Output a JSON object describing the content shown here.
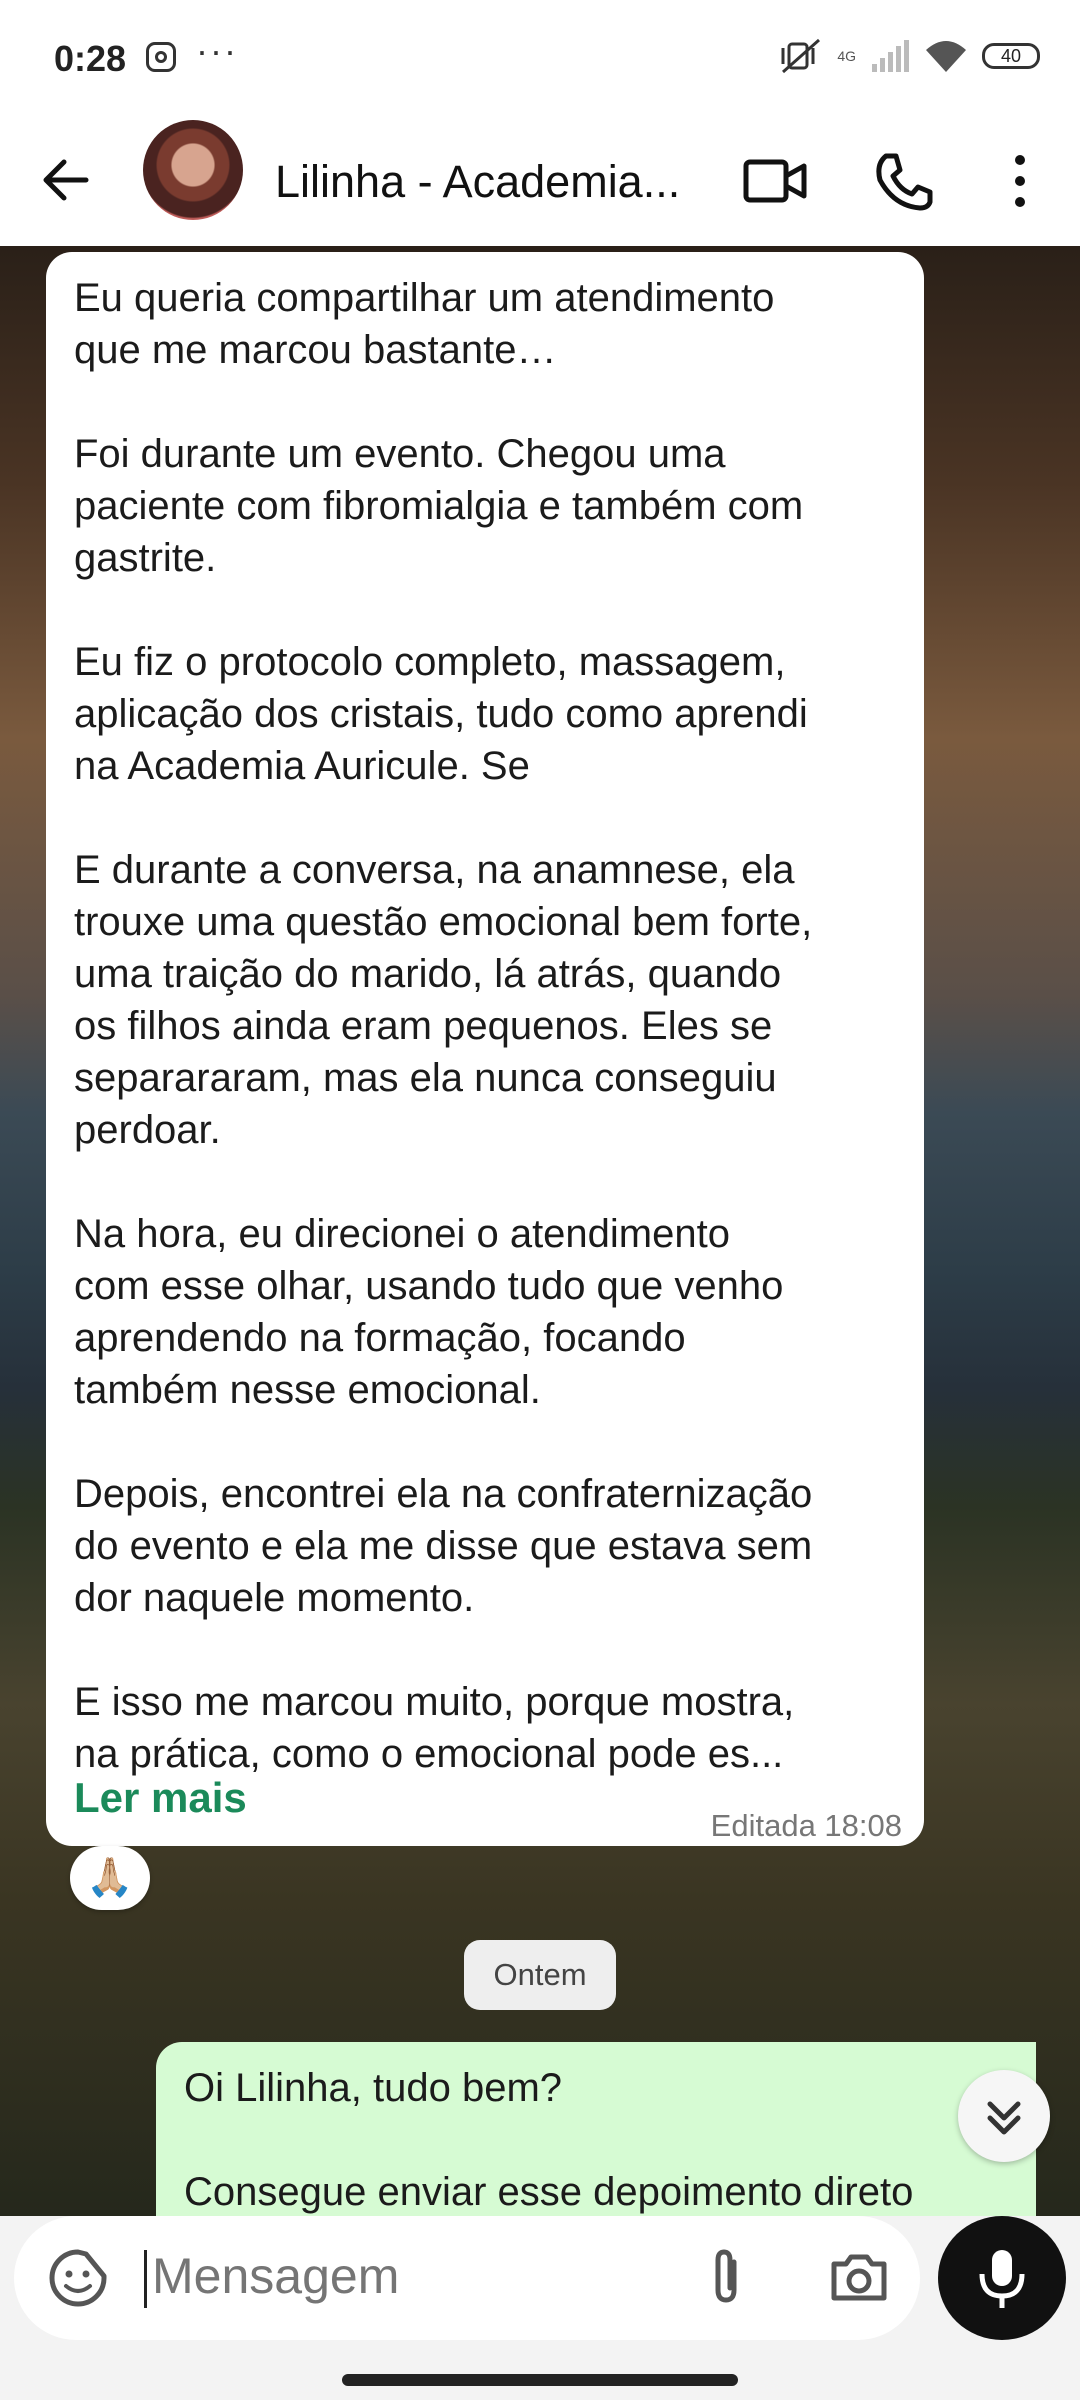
{
  "status_bar": {
    "time": "0:28",
    "battery": "40",
    "network": "4G"
  },
  "header": {
    "title": "Lilinha - Academia...",
    "icons": [
      "back-arrow-icon",
      "video-call-icon",
      "phone-icon",
      "more-vert-icon"
    ]
  },
  "messages": {
    "incoming": {
      "text": "Eu queria compartilhar um atendimento\nque me marcou bastante…\n\nFoi durante um evento. Chegou uma\npaciente com fibromialgia e também com\ngastrite.\n\nEu fiz o protocolo completo, massagem,\naplicação dos cristais, tudo como aprendi\nna Academia Auricule. Se\n\nE durante a conversa, na anamnese, ela\ntrouxe uma questão emocional bem forte,\numa traição do marido, lá atrás, quando\nos filhos ainda eram pequenos. Eles se\nseparararam, mas ela nunca conseguiu\nperdoar.\n\nNa hora, eu direcionei o atendimento\ncom esse olhar, usando tudo que venho\naprendendo na formação, focando\ntambém nesse emocional.\n\nDepois, encontrei ela na confraternização\ndo evento e ela me disse que estava sem\ndor naquele momento.\n\nE isso me marcou muito, porque mostra,\nna prática, como o emocional pode es...",
      "read_more": "Ler mais",
      "meta": "Editada 18:08",
      "reaction": "🙏🏼"
    },
    "day_separator": "Ontem",
    "outgoing": {
      "text": "Oi Lilinha, tudo bem?\n\nConsegue enviar esse depoimento direto"
    }
  },
  "composer": {
    "placeholder": "Mensagem"
  }
}
